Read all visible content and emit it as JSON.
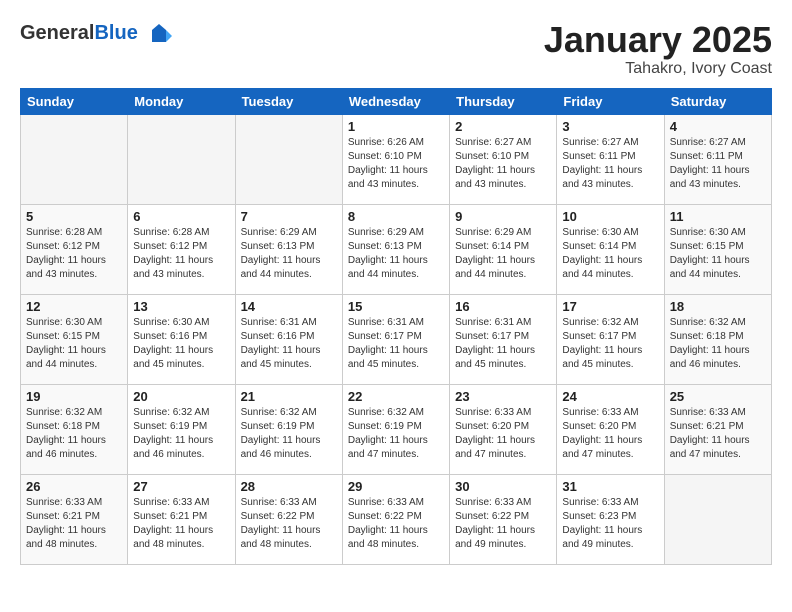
{
  "header": {
    "logo_general": "General",
    "logo_blue": "Blue",
    "month": "January 2025",
    "location": "Tahakro, Ivory Coast"
  },
  "weekdays": [
    "Sunday",
    "Monday",
    "Tuesday",
    "Wednesday",
    "Thursday",
    "Friday",
    "Saturday"
  ],
  "weeks": [
    [
      {
        "day": "",
        "info": ""
      },
      {
        "day": "",
        "info": ""
      },
      {
        "day": "",
        "info": ""
      },
      {
        "day": "1",
        "info": "Sunrise: 6:26 AM\nSunset: 6:10 PM\nDaylight: 11 hours\nand 43 minutes."
      },
      {
        "day": "2",
        "info": "Sunrise: 6:27 AM\nSunset: 6:10 PM\nDaylight: 11 hours\nand 43 minutes."
      },
      {
        "day": "3",
        "info": "Sunrise: 6:27 AM\nSunset: 6:11 PM\nDaylight: 11 hours\nand 43 minutes."
      },
      {
        "day": "4",
        "info": "Sunrise: 6:27 AM\nSunset: 6:11 PM\nDaylight: 11 hours\nand 43 minutes."
      }
    ],
    [
      {
        "day": "5",
        "info": "Sunrise: 6:28 AM\nSunset: 6:12 PM\nDaylight: 11 hours\nand 43 minutes."
      },
      {
        "day": "6",
        "info": "Sunrise: 6:28 AM\nSunset: 6:12 PM\nDaylight: 11 hours\nand 43 minutes."
      },
      {
        "day": "7",
        "info": "Sunrise: 6:29 AM\nSunset: 6:13 PM\nDaylight: 11 hours\nand 44 minutes."
      },
      {
        "day": "8",
        "info": "Sunrise: 6:29 AM\nSunset: 6:13 PM\nDaylight: 11 hours\nand 44 minutes."
      },
      {
        "day": "9",
        "info": "Sunrise: 6:29 AM\nSunset: 6:14 PM\nDaylight: 11 hours\nand 44 minutes."
      },
      {
        "day": "10",
        "info": "Sunrise: 6:30 AM\nSunset: 6:14 PM\nDaylight: 11 hours\nand 44 minutes."
      },
      {
        "day": "11",
        "info": "Sunrise: 6:30 AM\nSunset: 6:15 PM\nDaylight: 11 hours\nand 44 minutes."
      }
    ],
    [
      {
        "day": "12",
        "info": "Sunrise: 6:30 AM\nSunset: 6:15 PM\nDaylight: 11 hours\nand 44 minutes."
      },
      {
        "day": "13",
        "info": "Sunrise: 6:30 AM\nSunset: 6:16 PM\nDaylight: 11 hours\nand 45 minutes."
      },
      {
        "day": "14",
        "info": "Sunrise: 6:31 AM\nSunset: 6:16 PM\nDaylight: 11 hours\nand 45 minutes."
      },
      {
        "day": "15",
        "info": "Sunrise: 6:31 AM\nSunset: 6:17 PM\nDaylight: 11 hours\nand 45 minutes."
      },
      {
        "day": "16",
        "info": "Sunrise: 6:31 AM\nSunset: 6:17 PM\nDaylight: 11 hours\nand 45 minutes."
      },
      {
        "day": "17",
        "info": "Sunrise: 6:32 AM\nSunset: 6:17 PM\nDaylight: 11 hours\nand 45 minutes."
      },
      {
        "day": "18",
        "info": "Sunrise: 6:32 AM\nSunset: 6:18 PM\nDaylight: 11 hours\nand 46 minutes."
      }
    ],
    [
      {
        "day": "19",
        "info": "Sunrise: 6:32 AM\nSunset: 6:18 PM\nDaylight: 11 hours\nand 46 minutes."
      },
      {
        "day": "20",
        "info": "Sunrise: 6:32 AM\nSunset: 6:19 PM\nDaylight: 11 hours\nand 46 minutes."
      },
      {
        "day": "21",
        "info": "Sunrise: 6:32 AM\nSunset: 6:19 PM\nDaylight: 11 hours\nand 46 minutes."
      },
      {
        "day": "22",
        "info": "Sunrise: 6:32 AM\nSunset: 6:19 PM\nDaylight: 11 hours\nand 47 minutes."
      },
      {
        "day": "23",
        "info": "Sunrise: 6:33 AM\nSunset: 6:20 PM\nDaylight: 11 hours\nand 47 minutes."
      },
      {
        "day": "24",
        "info": "Sunrise: 6:33 AM\nSunset: 6:20 PM\nDaylight: 11 hours\nand 47 minutes."
      },
      {
        "day": "25",
        "info": "Sunrise: 6:33 AM\nSunset: 6:21 PM\nDaylight: 11 hours\nand 47 minutes."
      }
    ],
    [
      {
        "day": "26",
        "info": "Sunrise: 6:33 AM\nSunset: 6:21 PM\nDaylight: 11 hours\nand 48 minutes."
      },
      {
        "day": "27",
        "info": "Sunrise: 6:33 AM\nSunset: 6:21 PM\nDaylight: 11 hours\nand 48 minutes."
      },
      {
        "day": "28",
        "info": "Sunrise: 6:33 AM\nSunset: 6:22 PM\nDaylight: 11 hours\nand 48 minutes."
      },
      {
        "day": "29",
        "info": "Sunrise: 6:33 AM\nSunset: 6:22 PM\nDaylight: 11 hours\nand 48 minutes."
      },
      {
        "day": "30",
        "info": "Sunrise: 6:33 AM\nSunset: 6:22 PM\nDaylight: 11 hours\nand 49 minutes."
      },
      {
        "day": "31",
        "info": "Sunrise: 6:33 AM\nSunset: 6:23 PM\nDaylight: 11 hours\nand 49 minutes."
      },
      {
        "day": "",
        "info": ""
      }
    ]
  ]
}
